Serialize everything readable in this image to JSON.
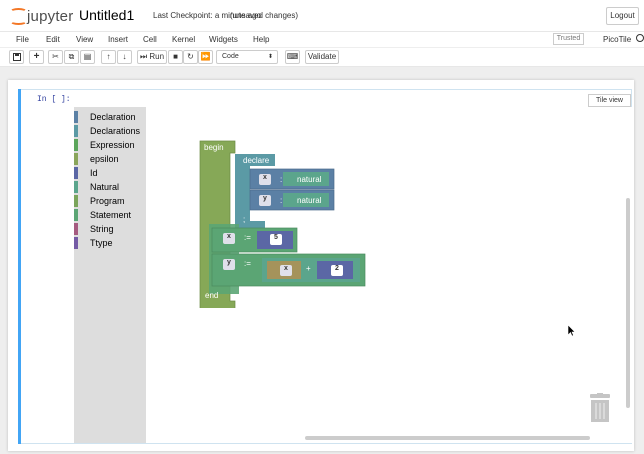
{
  "header": {
    "logo_text": "jupyter",
    "notebook_name": "Untitled1",
    "checkpoint": "Last Checkpoint: a minute ago",
    "unsaved": "(unsaved changes)",
    "logout": "Logout"
  },
  "menubar": {
    "items": [
      "File",
      "Edit",
      "View",
      "Insert",
      "Cell",
      "Kernel",
      "Widgets",
      "Help"
    ],
    "trusted": "Trusted",
    "kernel_name": "PicoTile"
  },
  "toolbar": {
    "run_label": "Run",
    "cell_type": "Code",
    "validate_label": "Validate"
  },
  "cell": {
    "prompt": "In [ ]:",
    "tile_view": "Tile view"
  },
  "toolbox": {
    "categories": [
      {
        "label": "Declaration",
        "color": "#5b80a5"
      },
      {
        "label": "Declarations",
        "color": "#5b9aa5"
      },
      {
        "label": "Expression",
        "color": "#5ba55b"
      },
      {
        "label": "epsilon",
        "color": "#8aa55b"
      },
      {
        "label": "Id",
        "color": "#5b67a5"
      },
      {
        "label": "Natural",
        "color": "#5ba58c"
      },
      {
        "label": "Program",
        "color": "#7ba55b"
      },
      {
        "label": "Statement",
        "color": "#5ba574"
      },
      {
        "label": "String",
        "color": "#a55b80"
      },
      {
        "label": "Ttype",
        "color": "#745ba5"
      }
    ]
  },
  "blocks": {
    "begin": "begin",
    "declare": "declare",
    "end": "end",
    "semicolon": ";",
    "assign": ":=",
    "colon": ":",
    "plus": "+",
    "decl_vars": [
      "x",
      "y"
    ],
    "decl_type": "natural",
    "assign1_var": "x",
    "assign1_value": "5",
    "assign2_var": "y",
    "assign2_left_var": "x",
    "assign2_right_value": "2"
  },
  "colors": {
    "program": "#86a857",
    "declarations": "#5b9aa5",
    "statement": "#5ba574",
    "id": "#5b67a5",
    "natural": "#5b67a5",
    "expression": "#5ba58c"
  }
}
